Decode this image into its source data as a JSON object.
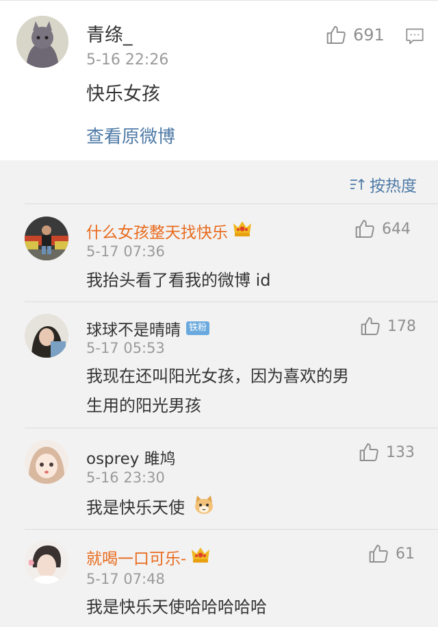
{
  "top_post": {
    "username": "青绦_",
    "time": "5-16 22:26",
    "text": "快乐女孩",
    "like_count": "691",
    "view_original": "查看原微博"
  },
  "sort": {
    "label": "按热度",
    "icon": "sort-icon"
  },
  "comments": [
    {
      "username": "什么女孩整天找快乐",
      "time": "5-17 07:36",
      "text": "我抬头看了看我的微博 id",
      "like_count": "644",
      "badge": "crown-badge"
    },
    {
      "username": "球球不是晴晴",
      "time": "5-17 05:53",
      "text_line1": "我现在还叫阳光女孩，因为喜欢的男",
      "text_line2": "生用的阳光男孩",
      "like_count": "178",
      "badge": "铁粉"
    },
    {
      "username": "osprey 雎鸠",
      "time": "5-16 23:30",
      "text": "我是快乐天使",
      "like_count": "133",
      "emoji": "cat-emoji"
    },
    {
      "username": "就喝一口可乐-",
      "time": "5-17 07:48",
      "text": "我是快乐天使哈哈哈哈哈",
      "like_count": "61",
      "badge": "crown-badge"
    }
  ],
  "colors": {
    "link_blue": "#4e7aa6",
    "vip_orange": "#e86b1e",
    "meta_gray": "#9a9a9a"
  }
}
